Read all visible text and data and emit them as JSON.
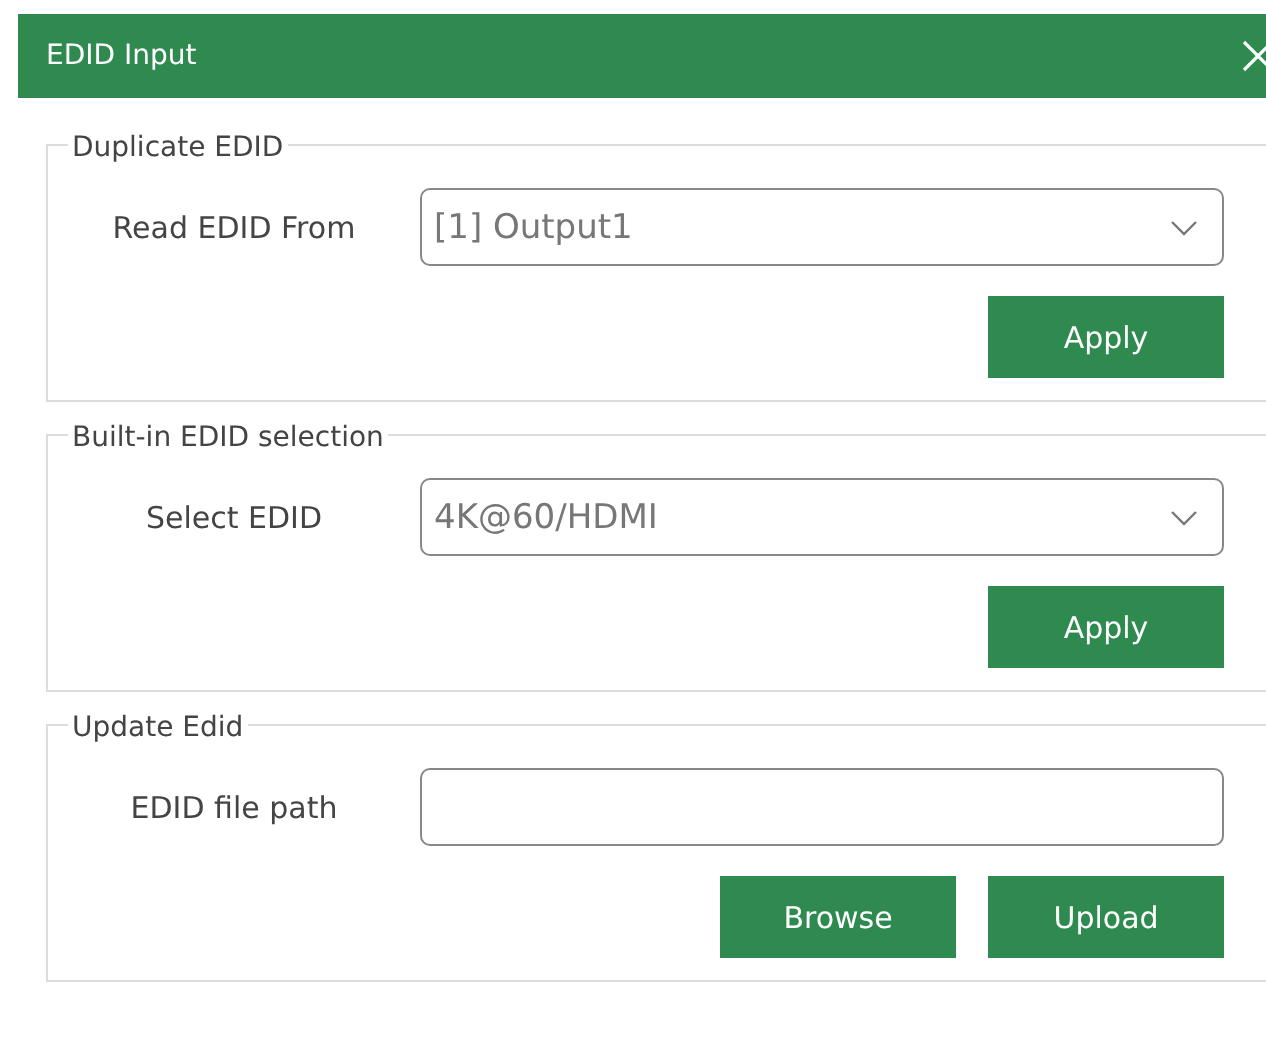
{
  "window": {
    "title": "EDID Input"
  },
  "groups": [
    {
      "title": "Duplicate EDID",
      "kind": "select",
      "label": "Read EDID From",
      "value": "[1] Output1",
      "buttons": [
        "Apply"
      ]
    },
    {
      "title": "Built-in EDID selection",
      "kind": "select",
      "label": "Select EDID",
      "value": "4K@60/HDMI",
      "buttons": [
        "Apply"
      ]
    },
    {
      "title": "Update Edid",
      "kind": "file",
      "label": "EDID file path",
      "buttons": [
        "Browse",
        "Upload"
      ]
    }
  ]
}
